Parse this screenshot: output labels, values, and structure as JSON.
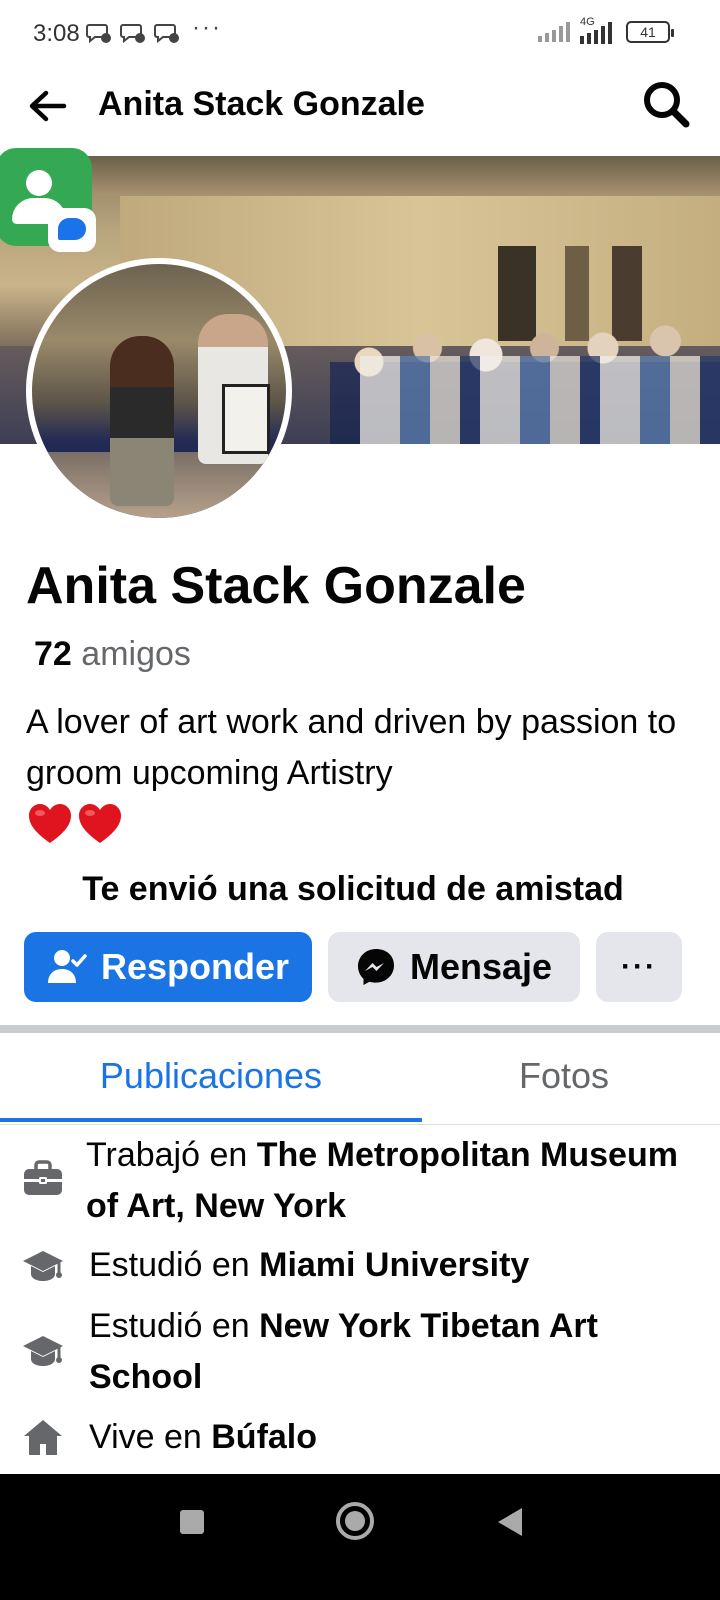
{
  "status_bar": {
    "time": "3:08",
    "more": "···",
    "network": "4G",
    "battery": "41"
  },
  "header": {
    "title": "Anita Stack Gonzale",
    "back_icon": "arrow-left-icon",
    "search_icon": "search-icon"
  },
  "profile": {
    "name": "Anita Stack Gonzale",
    "friends_count": "72",
    "friends_label": "amigos",
    "bio": "A lover of art work and driven by passion to groom upcoming Artistry",
    "bio_emoji": "❤️❤️",
    "request_text": "Te envió una solicitud de amistad"
  },
  "actions": {
    "respond_label": "Responder",
    "message_label": "Mensaje",
    "more_label": "···"
  },
  "tabs": [
    {
      "label": "Publicaciones",
      "active": true
    },
    {
      "label": "Fotos",
      "active": false
    }
  ],
  "details": [
    {
      "icon": "briefcase-icon",
      "prefix": "Trabajó en ",
      "value": "The Metropolitan Museum of Art, New York"
    },
    {
      "icon": "graduation-cap-icon",
      "prefix": "Estudió en ",
      "value": "Miami University"
    },
    {
      "icon": "graduation-cap-icon",
      "prefix": "Estudió en ",
      "value": "New York Tibetan Art School"
    },
    {
      "icon": "home-icon",
      "prefix": "Vive en ",
      "value": "Búfalo"
    }
  ],
  "colors": {
    "accent": "#1b74e4",
    "secondary_button": "#e4e6eb",
    "muted_text": "#65676b"
  }
}
